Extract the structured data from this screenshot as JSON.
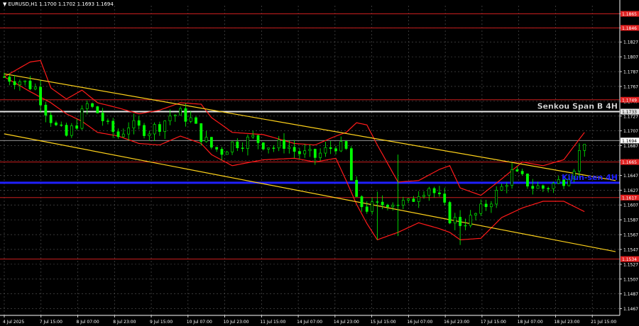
{
  "header": {
    "symbol_info": "EURUSD,H1  1.1700 1.1702 1.1693 1.1694"
  },
  "colors": {
    "background": "#000000",
    "grid": "#5a5a5a",
    "bull_candle": "#00ff00",
    "bear_candle": "#00ff00",
    "ichimoku": "#ff1a1a",
    "channel": "#ffd21a",
    "level_red": "#c81e1e",
    "senkou_line": "#e6e6e6",
    "kijun_line": "#2020ff",
    "price_line": "#c8c8c8",
    "axis_text": "#ffffff",
    "label_red_bg": "#e02020"
  },
  "chart_data": {
    "type": "candlestick",
    "symbol": "EURUSD",
    "timeframe": "H1",
    "y_ticks": [
      "1.1865",
      "1.1846",
      "1.1827",
      "1.1807",
      "1.1787",
      "1.1767",
      "1.1747",
      "1.1727",
      "1.1707",
      "1.1687",
      "1.1667",
      "1.1647",
      "1.1627",
      "1.1607",
      "1.1587",
      "1.1567",
      "1.1547",
      "1.1527",
      "1.1507",
      "1.1487",
      "1.1467"
    ],
    "ylim": [
      1.1458,
      1.1876
    ],
    "x_ticks": [
      "4 Jul 2025",
      "7 Jul 15:00",
      "8 Jul 07:00",
      "8 Jul 23:00",
      "9 Jul 15:00",
      "10 Jul 07:00",
      "10 Jul 23:00",
      "11 Jul 15:00",
      "14 Jul 07:00",
      "14 Jul 23:00",
      "15 Jul 15:00",
      "16 Jul 07:00",
      "16 Jul 23:00",
      "17 Jul 15:00",
      "18 Jul 07:00",
      "18 Jul 23:00",
      "21 Jul 15:00"
    ],
    "current_price": 1.1694,
    "levels": [
      {
        "price": 1.1865,
        "label": "1.1865",
        "style": "red"
      },
      {
        "price": 1.1846,
        "label": "1.1846",
        "style": "red"
      },
      {
        "price": 1.1749,
        "label": "1.1749",
        "style": "red"
      },
      {
        "price": 1.1733,
        "label": "1.1733",
        "style": "senkou",
        "name": "Senkou Span B 4H"
      },
      {
        "price": 1.1665,
        "label": "1.1665",
        "style": "red"
      },
      {
        "price": 1.1637,
        "label": "",
        "style": "kijun",
        "name": "Kijun-sen 4H"
      },
      {
        "price": 1.1617,
        "label": "1.1617",
        "style": "red"
      },
      {
        "price": 1.1534,
        "label": "1.1534",
        "style": "red"
      }
    ],
    "channel": {
      "upper": [
        [
          0,
          1.1784
        ],
        [
          118,
          1.164
        ]
      ],
      "lower": [
        [
          0,
          1.1703
        ],
        [
          118,
          1.1544
        ]
      ]
    },
    "close_path": [
      [
        0,
        1.178
      ],
      [
        3,
        1.1775
      ],
      [
        6,
        1.1765
      ],
      [
        8,
        1.1735
      ],
      [
        10,
        1.1712
      ],
      [
        12,
        1.17
      ],
      [
        14,
        1.1718
      ],
      [
        16,
        1.1742
      ],
      [
        18,
        1.1732
      ],
      [
        20,
        1.1712
      ],
      [
        22,
        1.17
      ],
      [
        24,
        1.1715
      ],
      [
        26,
        1.171
      ],
      [
        28,
        1.1708
      ],
      [
        30,
        1.1715
      ],
      [
        32,
        1.1728
      ],
      [
        34,
        1.173
      ],
      [
        36,
        1.1722
      ],
      [
        38,
        1.17
      ],
      [
        40,
        1.1685
      ],
      [
        42,
        1.168
      ],
      [
        44,
        1.169
      ],
      [
        46,
        1.1692
      ],
      [
        48,
        1.1697
      ],
      [
        50,
        1.169
      ],
      [
        52,
        1.1685
      ],
      [
        54,
        1.169
      ],
      [
        56,
        1.168
      ],
      [
        58,
        1.1675
      ],
      [
        60,
        1.1672
      ],
      [
        62,
        1.168
      ],
      [
        64,
        1.1688
      ],
      [
        66,
        1.168
      ],
      [
        67,
        1.164
      ],
      [
        68,
        1.161
      ],
      [
        70,
        1.1603
      ],
      [
        72,
        1.1605
      ],
      [
        74,
        1.1612
      ],
      [
        76,
        1.161
      ],
      [
        78,
        1.1608
      ],
      [
        80,
        1.1625
      ],
      [
        82,
        1.1632
      ],
      [
        84,
        1.1615
      ],
      [
        86,
        1.159
      ],
      [
        88,
        1.1583
      ],
      [
        90,
        1.1588
      ],
      [
        92,
        1.16
      ],
      [
        94,
        1.1615
      ],
      [
        96,
        1.163
      ],
      [
        98,
        1.165
      ],
      [
        100,
        1.1642
      ],
      [
        102,
        1.1632
      ],
      [
        104,
        1.163
      ],
      [
        106,
        1.1635
      ],
      [
        108,
        1.1642
      ],
      [
        110,
        1.166
      ],
      [
        112,
        1.1695
      ]
    ],
    "ichimoku_upper": [
      [
        0,
        1.178
      ],
      [
        5,
        1.18
      ],
      [
        7,
        1.1802
      ],
      [
        9,
        1.1765
      ],
      [
        12,
        1.175
      ],
      [
        15,
        1.1762
      ],
      [
        18,
        1.1745
      ],
      [
        22,
        1.1738
      ],
      [
        26,
        1.173
      ],
      [
        30,
        1.1735
      ],
      [
        34,
        1.1745
      ],
      [
        38,
        1.1743
      ],
      [
        40,
        1.1725
      ],
      [
        44,
        1.1705
      ],
      [
        50,
        1.1702
      ],
      [
        56,
        1.169
      ],
      [
        60,
        1.1688
      ],
      [
        64,
        1.17
      ],
      [
        66,
        1.1705
      ],
      [
        68,
        1.1718
      ],
      [
        70,
        1.1715
      ],
      [
        72,
        1.1688
      ],
      [
        76,
        1.1638
      ],
      [
        80,
        1.164
      ],
      [
        84,
        1.1655
      ],
      [
        86,
        1.166
      ],
      [
        88,
        1.163
      ],
      [
        92,
        1.162
      ],
      [
        96,
        1.1642
      ],
      [
        100,
        1.1665
      ],
      [
        104,
        1.166
      ],
      [
        108,
        1.1668
      ],
      [
        112,
        1.1705
      ]
    ],
    "ichimoku_lower": [
      [
        0,
        1.178
      ],
      [
        5,
        1.176
      ],
      [
        9,
        1.1745
      ],
      [
        12,
        1.173
      ],
      [
        15,
        1.172
      ],
      [
        18,
        1.1705
      ],
      [
        22,
        1.17
      ],
      [
        26,
        1.169
      ],
      [
        30,
        1.1688
      ],
      [
        34,
        1.17
      ],
      [
        38,
        1.169
      ],
      [
        40,
        1.1675
      ],
      [
        44,
        1.166
      ],
      [
        50,
        1.1668
      ],
      [
        56,
        1.167
      ],
      [
        60,
        1.1665
      ],
      [
        64,
        1.167
      ],
      [
        66,
        1.164
      ],
      [
        68,
        1.1608
      ],
      [
        70,
        1.1582
      ],
      [
        72,
        1.156
      ],
      [
        76,
        1.157
      ],
      [
        80,
        1.1583
      ],
      [
        84,
        1.1575
      ],
      [
        86,
        1.157
      ],
      [
        88,
        1.156
      ],
      [
        92,
        1.1562
      ],
      [
        96,
        1.159
      ],
      [
        100,
        1.1603
      ],
      [
        104,
        1.1612
      ],
      [
        108,
        1.1612
      ],
      [
        110,
        1.1605
      ],
      [
        112,
        1.1598
      ]
    ]
  }
}
